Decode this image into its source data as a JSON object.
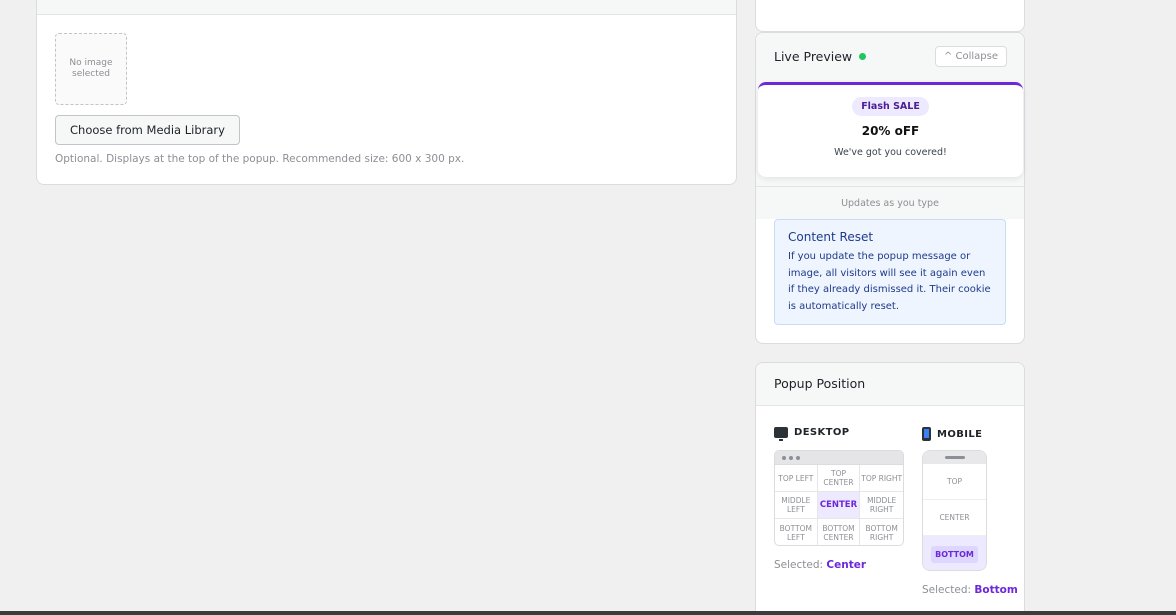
{
  "image_section": {
    "placeholder_text": "No image selected",
    "button_label": "Choose from Media Library",
    "help_text": "Optional. Displays at the top of the popup. Recommended size: 600 x 300 px."
  },
  "live_preview": {
    "title": "Live Preview",
    "status_color": "#22c55e",
    "collapse_label": "^ Collapse",
    "popup": {
      "badge": "Flash SALE",
      "headline": "20% oFF",
      "subtext": "We've got you covered!",
      "accent_color": "#6d28d9"
    },
    "updates_text": "Updates as you type"
  },
  "notice": {
    "title": "Content Reset",
    "body": "If you update the popup message or image, all visitors will see it again even if they already dismissed it. Their cookie is automatically reset."
  },
  "popup_position": {
    "title": "Popup Position",
    "desktop": {
      "label": "DESKTOP",
      "icon": "monitor-icon",
      "cells": [
        {
          "label": "TOP LEFT",
          "active": false
        },
        {
          "label": "TOP CENTER",
          "active": false
        },
        {
          "label": "TOP RIGHT",
          "active": false
        },
        {
          "label": "MIDDLE LEFT",
          "active": false
        },
        {
          "label": "CENTER",
          "active": true
        },
        {
          "label": "MIDDLE RIGHT",
          "active": false
        },
        {
          "label": "BOTTOM LEFT",
          "active": false
        },
        {
          "label": "BOTTOM CENTER",
          "active": false
        },
        {
          "label": "BOTTOM RIGHT",
          "active": false
        }
      ],
      "selected_prefix": "Selected:",
      "selected_value": "Center"
    },
    "mobile": {
      "label": "MOBILE",
      "icon": "phone-icon",
      "cells": [
        {
          "label": "TOP",
          "active": false
        },
        {
          "label": "CENTER",
          "active": false
        },
        {
          "label": "BOTTOM",
          "active": true
        }
      ],
      "selected_prefix": "Selected:",
      "selected_value": "Bottom"
    }
  }
}
